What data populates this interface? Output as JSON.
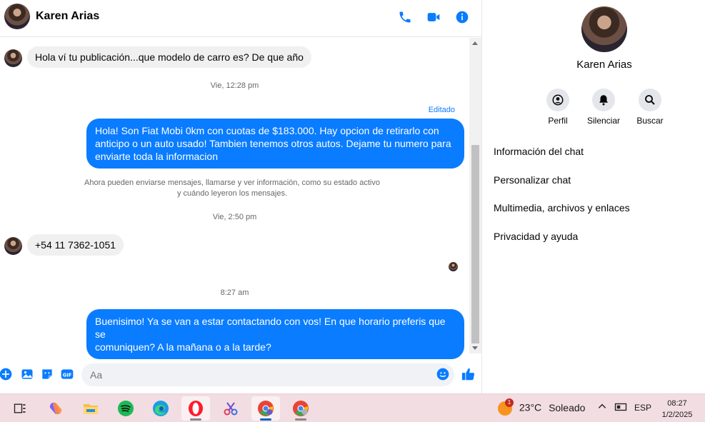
{
  "header": {
    "name": "Karen Arias"
  },
  "messages": {
    "m1": "Hola ví tu publicación...que modelo de carro es? De que año",
    "ts1": "Vie, 12:28 pm",
    "edited": "Editado",
    "m2_lines": [
      "Hola! Son Fiat Mobi 0km con cuotas de $183.000. Hay opcion de retirarlo con",
      "anticipo o un auto usado! Tambien tenemos otros autos. Dejame tu numero para",
      "enviarte toda la informacion"
    ],
    "notice_lines": [
      "Ahora pueden enviarse mensajes, llamarse y ver información, como su estado activo",
      "y cuándo leyeron los mensajes."
    ],
    "ts2": "Vie, 2:50 pm",
    "m3": "+54 11 7362-1051",
    "ts3": "8:27 am",
    "m4_lines": [
      "Buenisimo! Ya se van a estar contactando con vos! En que horario preferis que se",
      "comuniquen? A la mañana o a la tarde?"
    ]
  },
  "composer": {
    "placeholder": "Aa"
  },
  "side": {
    "name": "Karen Arias",
    "actions": [
      "Perfil",
      "Silenciar",
      "Buscar"
    ],
    "menu": [
      "Información del chat",
      "Personalizar chat",
      "Multimedia, archivos y enlaces",
      "Privacidad y ayuda"
    ]
  },
  "taskbar": {
    "weather_temp": "23°C",
    "weather_desc": "Soleado",
    "weather_badge": "1",
    "language": "ESP",
    "time": "08:27",
    "date": "1/2/2025"
  },
  "colors": {
    "accent": "#0a7cff",
    "taskbar": "#f2dde3"
  }
}
